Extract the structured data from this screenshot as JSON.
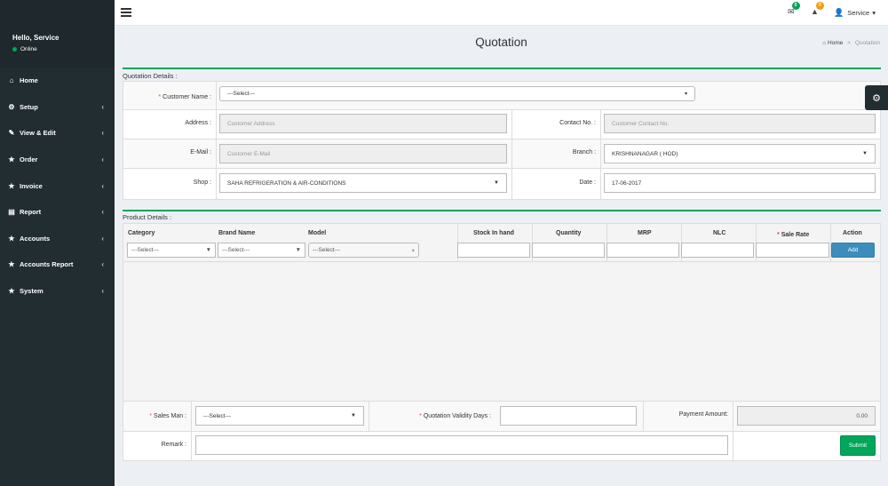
{
  "sidebar": {
    "user_greeting": "Hello, Service",
    "status": "Online",
    "items": [
      {
        "label": "Home",
        "icon": "home-icon",
        "glyph": "⌂",
        "has_caret": false
      },
      {
        "label": "Setup",
        "icon": "cogs-icon",
        "glyph": "⚙",
        "has_caret": true
      },
      {
        "label": "View & Edit",
        "icon": "edit-icon",
        "glyph": "✎",
        "has_caret": true
      },
      {
        "label": "Order",
        "icon": "star-icon",
        "glyph": "★",
        "has_caret": true
      },
      {
        "label": "Invoice",
        "icon": "star-icon",
        "glyph": "★",
        "has_caret": true
      },
      {
        "label": "Report",
        "icon": "file-icon",
        "glyph": "▤",
        "has_caret": true
      },
      {
        "label": "Accounts",
        "icon": "star-icon",
        "glyph": "★",
        "has_caret": true
      },
      {
        "label": "Accounts Report",
        "icon": "star-icon",
        "glyph": "★",
        "has_caret": true
      },
      {
        "label": "System",
        "icon": "star-icon",
        "glyph": "★",
        "has_caret": true
      }
    ]
  },
  "header": {
    "mail_badge": "0",
    "alert_badge": "0",
    "user_label": "Service",
    "caret": "▾"
  },
  "page": {
    "title": "Quotation",
    "breadcrumb_home": "Home",
    "breadcrumb_current": "Quotation",
    "breadcrumb_sep": ">"
  },
  "quotation_details": {
    "section_title": "Quotation Details :",
    "customer_name_label": "Customer Name :",
    "customer_name_value": "---Select---",
    "address_label": "Address :",
    "address_placeholder": "Customer Address",
    "contact_label": "Contact No. :",
    "contact_placeholder": "Customer Contact No.",
    "email_label": "E-Mail :",
    "email_placeholder": "Customer E-Mail",
    "branch_label": "Branch :",
    "branch_value": "KRISHNANAGAR ( HOD)",
    "shop_label": "Shop :",
    "shop_value": "SAHA REFRIGERATION & AIR-CONDITIONS",
    "date_label": "Date :",
    "date_value": "17-06-2017",
    "required_mark": "*"
  },
  "product_details": {
    "section_title": "Product Details :",
    "columns": {
      "category": "Category",
      "brand": "Brand Name",
      "model": "Model",
      "stock": "Stock In hand",
      "quantity": "Quantity",
      "mrp": "MRP",
      "nlc": "NLC",
      "sale_rate": "Sale Rate",
      "action": "Action"
    },
    "category_value": "---Select---",
    "brand_value": "---Select---",
    "model_value": "---Select---",
    "add_label": "Add"
  },
  "footer_form": {
    "salesman_label": "Sales Man :",
    "salesman_value": "---Select---",
    "validity_label": "Quotation Validity Days :",
    "payment_label": "Payment Amount:",
    "payment_value": "0.00",
    "remark_label": "Remark :",
    "submit_label": "Submit"
  },
  "icons": {
    "arrow_down": "▼",
    "caret_left": "‹"
  },
  "colors": {
    "sidebar_bg": "#222d32",
    "accent_green": "#00a65a",
    "primary_blue": "#3c8dbc",
    "required_red": "#dd4b39"
  }
}
